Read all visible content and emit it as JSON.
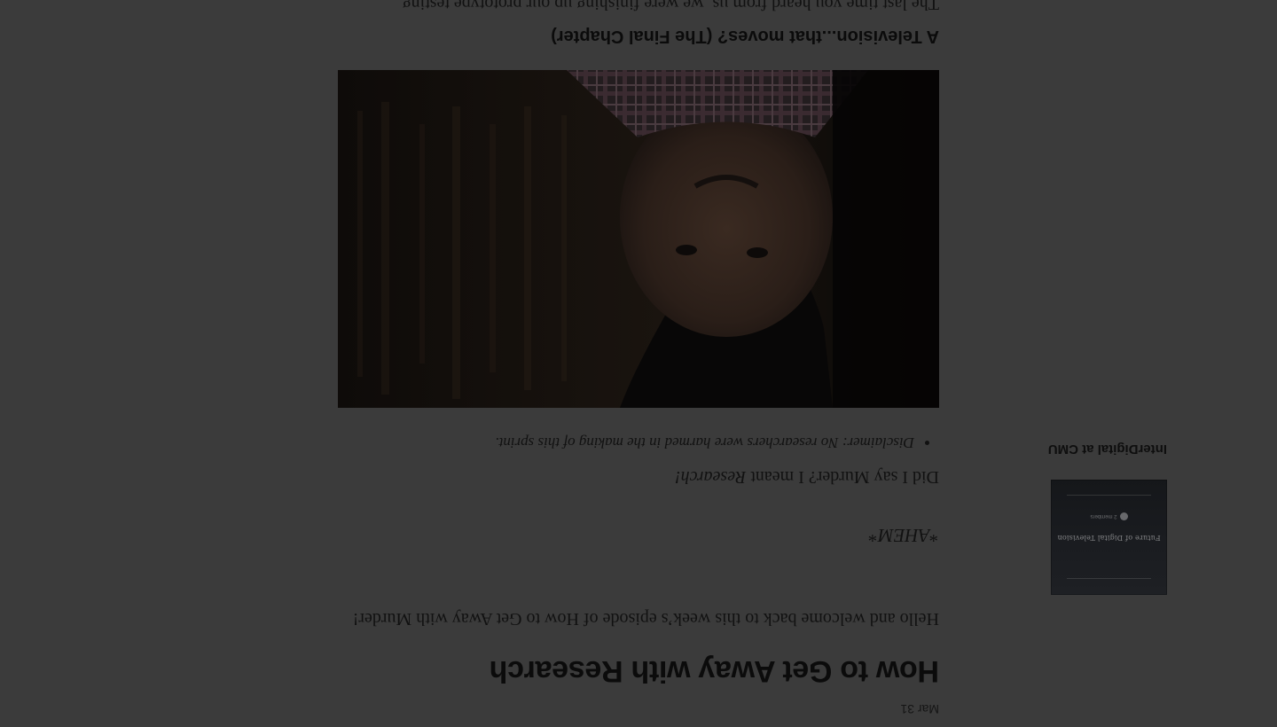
{
  "sidebar": {
    "title": "InterDigital at CMU",
    "thumbnail": {
      "caption": "Future of Digital Television",
      "meta": "2 members"
    }
  },
  "post": {
    "date": "Mar 31",
    "title": "How to Get Away with Research",
    "intro": "Hello and welcome back to this week’s episode of How to Get Away with Murder!",
    "ahem": "*AHEM*",
    "research_prefix": "Did I say Murder? I meant ",
    "research_em": "Research!",
    "bullets": [
      "Disclaimer: No researchers were harmed in the making of this sprint."
    ],
    "section_title": "A Television...that moves? (The Final Chapter)",
    "section_text": "The last time you heard from us, we were finishing up our prototype testing"
  },
  "colors": {
    "overlay": "#3b3b3b",
    "text": "#111111"
  }
}
